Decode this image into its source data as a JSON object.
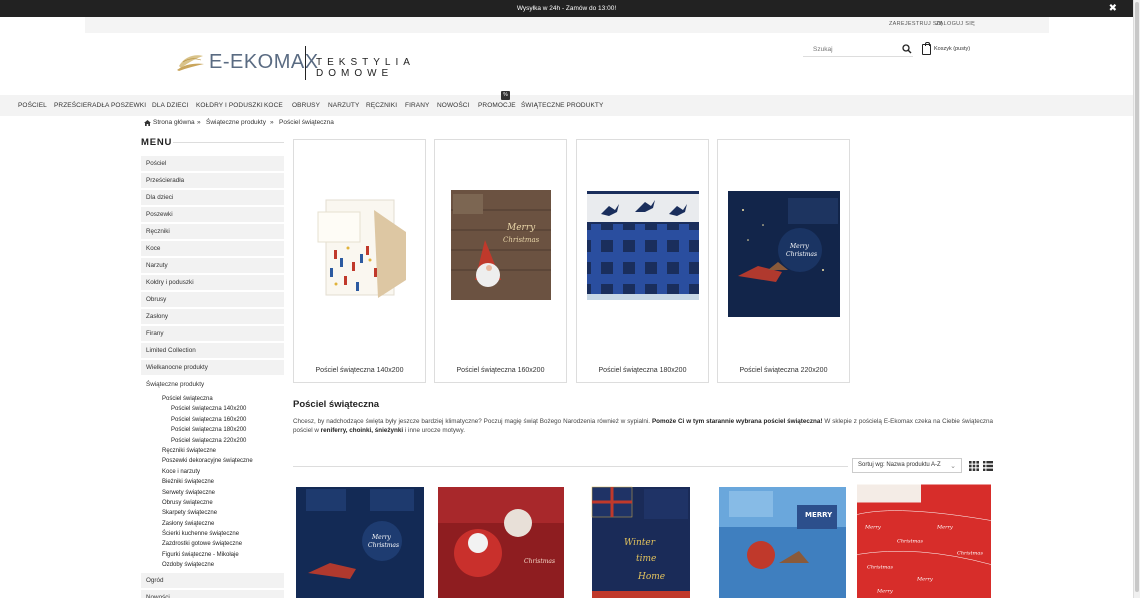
{
  "topbar": {
    "message": "Wysyłka w 24h - Zamów do 13:00!",
    "close_icon": "close-icon"
  },
  "userbar": {
    "register": "ZAREJESTRUJ SIĘ",
    "login": "ZALOGUJ SIĘ"
  },
  "logo": {
    "brand": "E-EKOMAX",
    "tagline": "TEKSTYLIA DOMOWE"
  },
  "search": {
    "placeholder": "Szukaj",
    "icon": "search-icon"
  },
  "cart": {
    "label": "Koszyk (pusty)",
    "icon": "shopping-bag-icon"
  },
  "nav": {
    "items": [
      "POŚCIEL",
      "PRZEŚCIERADŁA",
      "POSZEWKI",
      "DLA DZIECI",
      "KOŁDRY I PODUSZKI",
      "KOCE",
      "OBRUSY",
      "NARZUTY",
      "RĘCZNIKI",
      "FIRANY",
      "NOWOŚCI",
      "PROMOCJE",
      "ŚWIĄTECZNE PRODUKTY"
    ],
    "promo_badge": "%"
  },
  "breadcrumb": {
    "home": "Strona główna",
    "sep": "»",
    "level1": "Świąteczne produkty",
    "level2": "Pościel świąteczna",
    "icon": "home-icon"
  },
  "sidebar": {
    "title": "MENU",
    "items": [
      "Pościel",
      "Prześcieradła",
      "Dla dzieci",
      "Poszewki",
      "Ręczniki",
      "Koce",
      "Narzuty",
      "Kołdry i poduszki",
      "Obrusy",
      "Zasłony",
      "Firany",
      "Limited Collection",
      "Wielkanocne produkty",
      "Świąteczne produkty"
    ],
    "sub": [
      "Pościel świąteczna",
      "Pościel świąteczna 140x200",
      "Pościel świąteczna 160x200",
      "Pościel świąteczna 180x200",
      "Pościel świąteczna 220x200",
      "Ręczniki świąteczne",
      "Poszewki dekoracyjne świąteczne",
      "Koce i narzuty",
      "Bieżniki świąteczne",
      "Serwety świąteczne",
      "Obrusy świąteczne",
      "Skarpety świąteczne",
      "Zasłony świąteczne",
      "Ścierki kuchenne świąteczne",
      "Zazdrostki gotowe świąteczne",
      "Figurki świąteczne - Mikołaje",
      "Ozdoby świąteczne"
    ],
    "after": [
      "Ogród",
      "Nowości"
    ]
  },
  "categories": [
    {
      "name": "Pościel świąteczna 140x200"
    },
    {
      "name": "Pościel świąteczna 160x200"
    },
    {
      "name": "Pościel świąteczna 180x200"
    },
    {
      "name": "Pościel świąteczna 220x200"
    }
  ],
  "section": {
    "title": "Pościel świąteczna",
    "desc_part1": "Chcesz, by nadchodzące święta były jeszcze bardziej klimatyczne? Poczuj magię świąt Bożego Narodzenia również w sypialni. ",
    "desc_bold1": "Pomoże Ci w tym starannie wybrana pościel świąteczna!",
    "desc_part2": " W sklepie z pościelą E-Ekomax czeka na Ciebie świąteczna pościel w ",
    "desc_bold2": "reniferry, choinki, śnieżynki",
    "desc_part3": " i inne urocze motywy."
  },
  "sort": {
    "label": "Sortuj wg: Nazwa produktu A-Z",
    "chevron": "chevron-down-icon"
  },
  "view_icons": {
    "grid": "grid-view-icon",
    "list": "list-view-icon"
  }
}
